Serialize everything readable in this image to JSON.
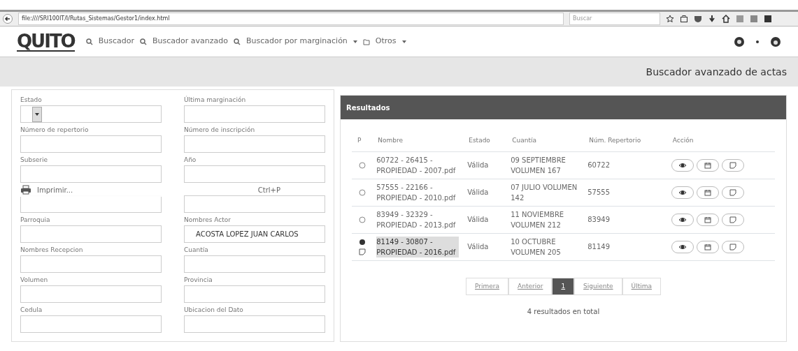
{
  "browser": {
    "url": "file:////SRI100IT/I/Rutas_Sistemas/Gestor1/index.html",
    "search_placeholder": "Buscar"
  },
  "navbar": {
    "logo": "QUITO",
    "items": [
      {
        "label": "Buscador",
        "dropdown": false
      },
      {
        "label": "Buscador avanzado",
        "dropdown": false
      },
      {
        "label": "Buscador por marginación",
        "dropdown": true
      },
      {
        "label": "Otros",
        "dropdown": true
      }
    ]
  },
  "page_title": "Buscador avanzado de actas",
  "form": {
    "fields": [
      {
        "label": "Estado",
        "kind": "select"
      },
      {
        "label": "Última marginación",
        "kind": "text"
      },
      {
        "label": "Número de repertorio",
        "kind": "text"
      },
      {
        "label": "Número de inscripción",
        "kind": "text"
      },
      {
        "label": "Subserie",
        "kind": "text"
      },
      {
        "label": "Año",
        "kind": "text"
      },
      {
        "kind": "text"
      },
      {
        "kind": "text"
      },
      {
        "label": "Parroquia",
        "kind": "text"
      },
      {
        "label": "Nombres Actor",
        "kind": "text",
        "value": "ACOSTA LOPEZ JUAN CARLOS"
      },
      {
        "label": "Nombres Recepcion",
        "kind": "text"
      },
      {
        "label": "Cuantía",
        "kind": "text"
      },
      {
        "label": "Volumen",
        "kind": "text"
      },
      {
        "label": "Provincia",
        "kind": "text"
      },
      {
        "label": "Cedula",
        "kind": "text"
      },
      {
        "label": "Ubicacion del Dato",
        "kind": "text"
      }
    ],
    "print_menu": {
      "label": "Imprimir...",
      "shortcut": "Ctrl+P"
    }
  },
  "results": {
    "title": "Resultados",
    "columns": [
      "P",
      "Nombre",
      "Estado",
      "Cuantía",
      "Núm. Repertorio",
      "Acción"
    ],
    "rows": [
      {
        "selected": false,
        "marked": false,
        "name": "60722 - 26415 - PROPIEDAD - 2007.pdf",
        "estado": "Válida",
        "cuantia": "09 SEPTIEMBRE VOLUMEN 167",
        "repertorio": "60722"
      },
      {
        "selected": false,
        "marked": false,
        "name": "57555 - 22166 - PROPIEDAD - 2010.pdf",
        "estado": "Válida",
        "cuantia": "07 JULIO VOLUMEN 142",
        "repertorio": "57555"
      },
      {
        "selected": false,
        "marked": false,
        "name": "83949 - 32329 - PROPIEDAD - 2013.pdf",
        "estado": "Válida",
        "cuantia": "11 NOVIEMBRE VOLUMEN 212",
        "repertorio": "83949"
      },
      {
        "selected": true,
        "marked": true,
        "name": "81149 - 30807 - PROPIEDAD - 2016.pdf",
        "estado": "Válida",
        "cuantia": "10 OCTUBRE VOLUMEN 205",
        "repertorio": "81149"
      }
    ],
    "pagination": [
      {
        "label": "Primera",
        "selected": false
      },
      {
        "label": "Anterior",
        "selected": false
      },
      {
        "label": "1",
        "selected": true
      },
      {
        "label": "Siguiente",
        "selected": false
      },
      {
        "label": "Última",
        "selected": false
      }
    ],
    "total": "4 resultados en total"
  }
}
